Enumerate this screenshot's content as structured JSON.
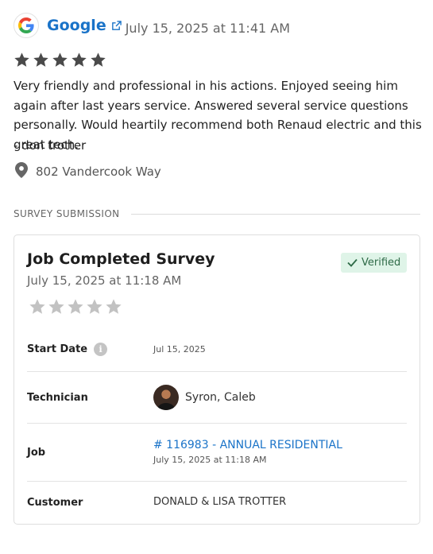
{
  "review": {
    "source_label": "Google",
    "source_icon": "google-g-icon",
    "date": "July 15, 2025 at 11:41 AM",
    "rating": 5,
    "text": "Very friendly and professional in his actions. Enjoyed seeing him again after last years service. Answered several service questions personally. Would heartily recommend both Renaud electric and this great tech.",
    "reviewer": "- don trotter",
    "location": "802 Vandercook Way",
    "colors": {
      "link": "#1a73c8",
      "star": "#4a4a4a"
    }
  },
  "section": {
    "title": "SURVEY SUBMISSION"
  },
  "survey": {
    "title": "Job Completed Survey",
    "date": "July 15, 2025 at 11:18 AM",
    "badge": "Verified",
    "rating": 0,
    "colors": {
      "badge_bg": "#dff4e8",
      "badge_text": "#2e6a47",
      "empty_star": "#c2c2c2"
    },
    "fields": {
      "start_date": {
        "label": "Start Date",
        "value": "Jul 15, 2025"
      },
      "technician": {
        "label": "Technician",
        "value": "Syron, Caleb"
      },
      "job": {
        "label": "Job",
        "link": "# 116983 - ANNUAL RESIDENTIAL",
        "date": "July 15, 2025 at 11:18 AM"
      },
      "customer": {
        "label": "Customer",
        "value": "DONALD & LISA TROTTER"
      }
    }
  }
}
